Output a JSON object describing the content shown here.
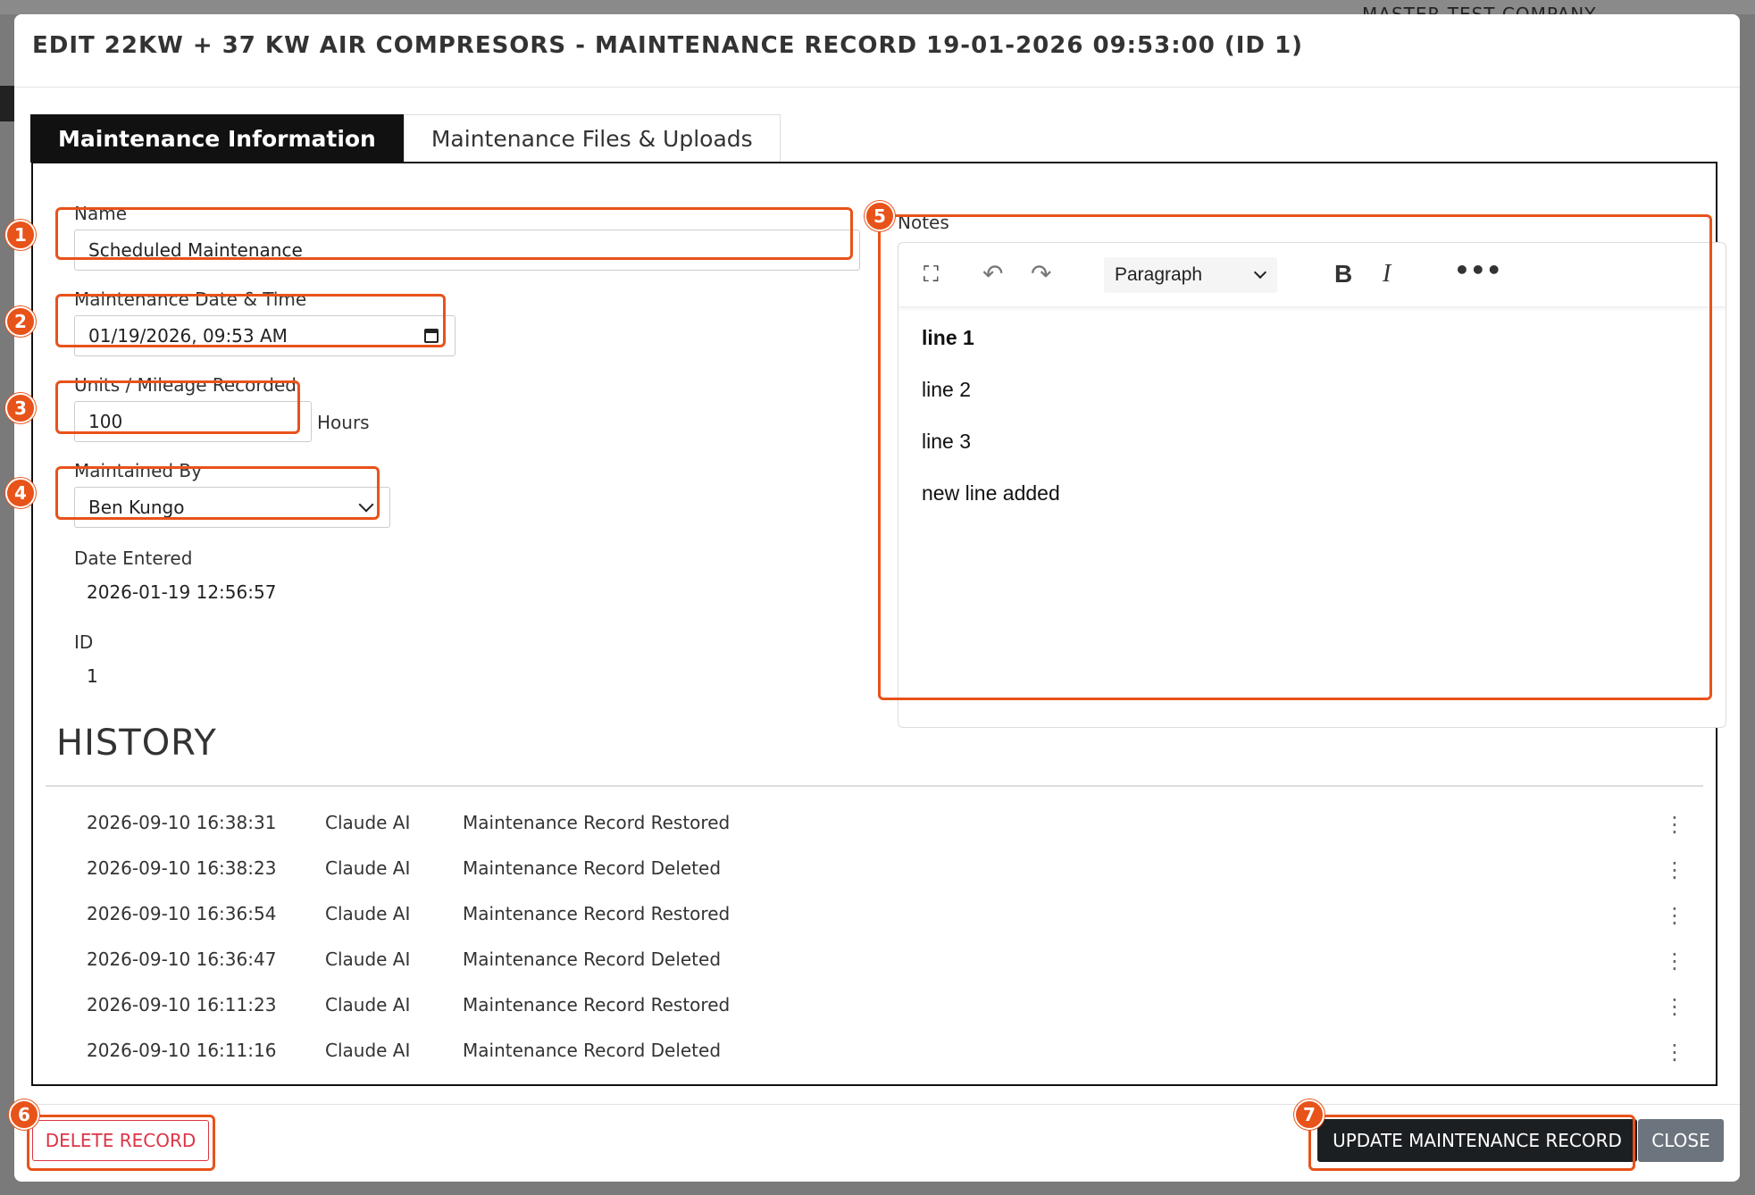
{
  "background": {
    "company": "MASTER TEST COMPANY"
  },
  "modal": {
    "title": "EDIT 22KW + 37 KW AIR COMPRESORS - MAINTENANCE RECORD 19-01-2026 09:53:00 (ID 1)"
  },
  "tabs": [
    {
      "label": "Maintenance Information",
      "active": true
    },
    {
      "label": "Maintenance Files & Uploads",
      "active": false
    }
  ],
  "form": {
    "name": {
      "label": "Name",
      "value": "Scheduled Maintenance"
    },
    "datetime": {
      "label": "Maintenance Date & Time",
      "value": "01/19/2026, 09:53 AM"
    },
    "units": {
      "label": "Units / Mileage Recorded",
      "value": "100",
      "suffix": "Hours"
    },
    "maintained_by": {
      "label": "Maintained By",
      "value": "Ben Kungo"
    },
    "date_entered": {
      "label": "Date Entered",
      "value": "2026-01-19 12:56:57"
    },
    "id": {
      "label": "ID",
      "value": "1"
    }
  },
  "notes": {
    "label": "Notes",
    "block_format": "Paragraph",
    "lines": [
      "line 1",
      "line 2",
      "line 3",
      "new line added"
    ]
  },
  "history": {
    "title": "HISTORY",
    "rows": [
      {
        "timestamp": "2026-09-10 16:38:31",
        "user": "Claude AI",
        "action": "Maintenance Record Restored"
      },
      {
        "timestamp": "2026-09-10 16:38:23",
        "user": "Claude AI",
        "action": "Maintenance Record Deleted"
      },
      {
        "timestamp": "2026-09-10 16:36:54",
        "user": "Claude AI",
        "action": "Maintenance Record Restored"
      },
      {
        "timestamp": "2026-09-10 16:36:47",
        "user": "Claude AI",
        "action": "Maintenance Record Deleted"
      },
      {
        "timestamp": "2026-09-10 16:11:23",
        "user": "Claude AI",
        "action": "Maintenance Record Restored"
      },
      {
        "timestamp": "2026-09-10 16:11:16",
        "user": "Claude AI",
        "action": "Maintenance Record Deleted"
      }
    ]
  },
  "buttons": {
    "delete": "DELETE RECORD",
    "update": "UPDATE MAINTENANCE RECORD",
    "close": "CLOSE"
  },
  "annotations": [
    "1",
    "2",
    "3",
    "4",
    "5",
    "6",
    "7"
  ],
  "colors": {
    "highlight": "#e8531a",
    "active_tab": "#111111",
    "danger": "#dc3545",
    "primary_dark": "#1c1f22",
    "secondary": "#6c757d"
  }
}
